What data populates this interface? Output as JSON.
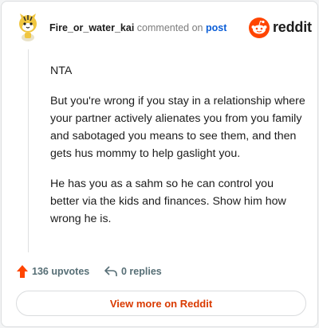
{
  "header": {
    "username": "Fire_or_water_kai",
    "action_text": "commented on",
    "target_link": "post",
    "avatar_icon": "tiger-avatar-icon"
  },
  "brand": {
    "logo_icon": "reddit-alien-icon",
    "wordmark": "reddit",
    "accent_color": "#ff4500"
  },
  "comment": {
    "paragraphs": [
      "NTA",
      "But you're wrong if you stay in a relationship where your partner actively alienates you from you family and sabotaged you means to see them, and then gets hus mommy to help gaslight you.",
      "He has you as a sahm so he can control you better via the kids and finances. Show him how wrong he is."
    ]
  },
  "actions": {
    "upvotes_label": "136 upvotes",
    "replies_label": "0 replies",
    "upvote_icon": "upvote-arrow-icon",
    "reply_icon": "reply-arrow-icon",
    "upvote_color": "#ff4500"
  },
  "footer": {
    "view_more_label": "View more on Reddit",
    "view_more_color": "#d93a00"
  }
}
